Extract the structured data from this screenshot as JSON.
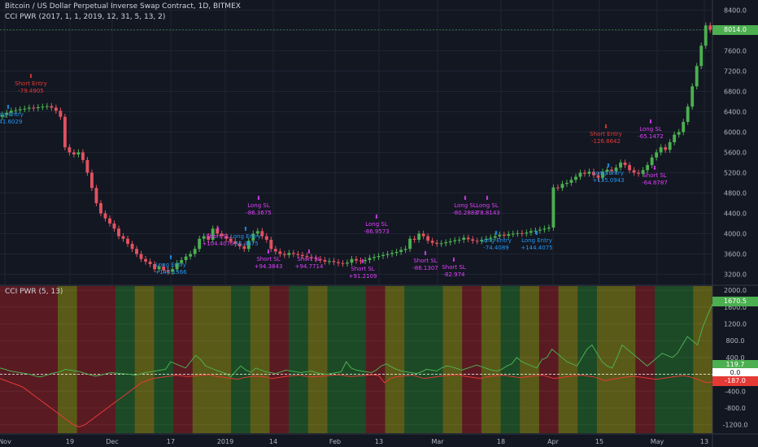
{
  "header": {
    "symbol_title": "Bitcoin / US Dollar Perpetual Inverse Swap Contract, 1D, BITMEX",
    "study_title": "CCI PWR (2017, 1, 1, 2019, 12, 31, 5, 13, 2)",
    "indicator_title": "CCI PWR (5, 13)"
  },
  "colors": {
    "background": "#131722",
    "up_candle": "#4caf50",
    "down_candle": "#e05260",
    "long_signal": "#2196f3",
    "short_signal": "#e040fb",
    "entry_short": "#e53935",
    "cci_up": "#4caf50",
    "cci_down": "#e53935",
    "current_price_box": "#4caf50"
  },
  "price_axis": {
    "ticks": [
      "8400.0",
      "8000.0",
      "7600.0",
      "7200.0",
      "6800.0",
      "6400.0",
      "6000.0",
      "5600.0",
      "5200.0",
      "4800.0",
      "4400.0",
      "4000.0",
      "3600.0",
      "3200.0"
    ],
    "current": "8014.0"
  },
  "osc_axis": {
    "ticks": [
      "2000.0",
      "1600.0",
      "1200.0",
      "800.0",
      "400.0",
      "0.0",
      "-400.0",
      "-800.0",
      "-1200.0"
    ],
    "value_up": "1670.5",
    "value_mid": "119.7",
    "value_zero": "0.0",
    "value_down": "-187.0"
  },
  "time_axis": [
    "Nov",
    "19",
    "Dec",
    "17",
    "2019",
    "14",
    "Feb",
    "13",
    "Mar",
    "18",
    "Apr",
    "15",
    "May",
    "13"
  ],
  "chart_data": {
    "type": "candlestick",
    "series_prices": [
      6340,
      6380,
      6420,
      6430,
      6450,
      6460,
      6480,
      6470,
      6490,
      6500,
      6510,
      6480,
      6420,
      6300,
      5700,
      5600,
      5560,
      5600,
      5450,
      5200,
      4900,
      4600,
      4400,
      4300,
      4200,
      4100,
      3950,
      3900,
      3800,
      3700,
      3600,
      3500,
      3450,
      3400,
      3300,
      3350,
      3280,
      3250,
      3300,
      3420,
      3480,
      3550,
      3600,
      3700,
      3900,
      3950,
      3880,
      4100,
      4000,
      3950,
      3900,
      3850,
      3800,
      3750,
      3700,
      3860,
      4000,
      4050,
      3950,
      3880,
      3700,
      3650,
      3600,
      3580,
      3620,
      3600,
      3580,
      3560,
      3540,
      3520,
      3500,
      3480,
      3450,
      3460,
      3440,
      3420,
      3410,
      3430,
      3500,
      3470,
      3460,
      3480,
      3520,
      3540,
      3560,
      3580,
      3600,
      3620,
      3640,
      3680,
      3700,
      3900,
      3880,
      4000,
      3950,
      3860,
      3820,
      3800,
      3810,
      3830,
      3850,
      3870,
      3880,
      3920,
      3890,
      3860,
      3850,
      3880,
      3900,
      3920,
      3950,
      3980,
      3960,
      3990,
      4000,
      4010,
      4000,
      4020,
      4050,
      4060,
      4080,
      4100,
      4120,
      4910,
      4900,
      4980,
      5000,
      5060,
      5120,
      5200,
      5180,
      5220,
      5150,
      5100,
      5220,
      5260,
      5230,
      5300,
      5400,
      5350,
      5250,
      5200,
      5180,
      5250,
      5350,
      5500,
      5600,
      5700,
      5650,
      5800,
      5950,
      6000,
      6200,
      6500,
      6900,
      7300,
      7700,
      8100,
      8014
    ],
    "signals": [
      {
        "text": "Long Entry",
        "value": "+41.6029",
        "color": "long"
      },
      {
        "text": "Short Entry",
        "value": "-79.4905",
        "color": "short_entry"
      },
      {
        "text": "Long Entry",
        "value": "+144.1566",
        "color": "long"
      },
      {
        "text": "Short SL",
        "value": "+104.4075",
        "color": "short"
      },
      {
        "text": "Long SL",
        "value": "-86.3675",
        "color": "short"
      },
      {
        "text": "Long Entry",
        "value": "-86.3675",
        "color": "long"
      },
      {
        "text": "Short SL",
        "value": "+94.3843",
        "color": "short"
      },
      {
        "text": "Short SL",
        "value": "+94.7714",
        "color": "short"
      },
      {
        "text": "Short SL",
        "value": "+91.2109",
        "color": "short"
      },
      {
        "text": "Long SL",
        "value": "-86.9573",
        "color": "short"
      },
      {
        "text": "Short SL",
        "value": "-86.1307",
        "color": "short"
      },
      {
        "text": "Short SL",
        "value": "-82.974",
        "color": "short"
      },
      {
        "text": "Long SL",
        "value": "-80.2883",
        "color": "short"
      },
      {
        "text": "Long SL",
        "value": "-78.8143",
        "color": "short"
      },
      {
        "text": "Long Entry",
        "value": "-74.4089",
        "color": "long"
      },
      {
        "text": "Long Entry",
        "value": "+144.4075",
        "color": "long"
      },
      {
        "text": "Short Entry",
        "value": "-126.8642",
        "color": "short_entry"
      },
      {
        "text": "Long SL",
        "value": "-65.1472",
        "color": "short"
      },
      {
        "text": "Long Entry",
        "value": "+135.0943",
        "color": "long"
      },
      {
        "text": "Short SL",
        "value": "-64.8787",
        "color": "short"
      }
    ],
    "cci_up_values": [
      150,
      120,
      80,
      60,
      40,
      20,
      0,
      -40,
      -60,
      -30,
      10,
      40,
      60,
      120,
      100,
      80,
      60,
      20,
      -10,
      -40,
      -20,
      10,
      40,
      30,
      20,
      10,
      0,
      -20,
      10,
      40,
      60,
      80,
      100,
      120,
      300,
      250,
      200,
      150,
      300,
      450,
      350,
      200,
      150,
      100,
      60,
      20,
      -60,
      80,
      200,
      100,
      50,
      150,
      100,
      60,
      40,
      20,
      60,
      100,
      80,
      60,
      40,
      60,
      80,
      40,
      20,
      0,
      20,
      40,
      60,
      300,
      150,
      100,
      80,
      60,
      40,
      100,
      200,
      250,
      180,
      120,
      80,
      60,
      40,
      20,
      60,
      120,
      100,
      80,
      150,
      200,
      180,
      140,
      100,
      140,
      180,
      220,
      180,
      140,
      100,
      80,
      120,
      200,
      250,
      400,
      300,
      250,
      200,
      150,
      350,
      400,
      600,
      500,
      400,
      300,
      250,
      200,
      400,
      600,
      700,
      500,
      300,
      200,
      150,
      400,
      700,
      600,
      500,
      400,
      300,
      200,
      300,
      400,
      500,
      450,
      400,
      500,
      700,
      900,
      800,
      700,
      1100,
      1400,
      1670
    ],
    "cci_down_values": [
      -100,
      -150,
      -200,
      -250,
      -300,
      -400,
      -500,
      -600,
      -700,
      -800,
      -900,
      -1000,
      -1100,
      -1200,
      -1250,
      -1200,
      -1100,
      -1000,
      -900,
      -800,
      -700,
      -600,
      -500,
      -400,
      -300,
      -200,
      -150,
      -100,
      -80,
      -60,
      -40,
      -20,
      -30,
      -50,
      -40,
      -30,
      -20,
      -10,
      -40,
      -60,
      -80,
      -100,
      -120,
      -80,
      -60,
      -40,
      -50,
      -60,
      -100,
      -80,
      -60,
      -40,
      -30,
      -20,
      -40,
      -60,
      -50,
      -40,
      -30,
      -20,
      -10,
      -30,
      -50,
      -40,
      -30,
      -20,
      -10,
      -30,
      -200,
      -100,
      -60,
      -40,
      -30,
      -20,
      -60,
      -100,
      -80,
      -60,
      -40,
      -30,
      -20,
      -10,
      -40,
      -60,
      -80,
      -100,
      -60,
      -40,
      -30,
      -20,
      -40,
      -60,
      -80,
      -60,
      -40,
      -30,
      -20,
      -60,
      -100,
      -80,
      -60,
      -40,
      -30,
      -20,
      -40,
      -60,
      -100,
      -150,
      -120,
      -100,
      -80,
      -60,
      -40,
      -60,
      -80,
      -100,
      -120,
      -100,
      -80,
      -60,
      -40,
      -30,
      -60,
      -100,
      -150,
      -200,
      -187
    ],
    "background_zones": [
      "red",
      "red",
      "red",
      "olive",
      "red",
      "red",
      "green",
      "olive",
      "green",
      "red",
      "olive",
      "olive",
      "green",
      "olive",
      "red",
      "green",
      "olive",
      "green",
      "green",
      "red",
      "olive",
      "green",
      "green",
      "olive",
      "red",
      "olive",
      "green",
      "olive",
      "red",
      "olive",
      "green",
      "olive",
      "olive",
      "red",
      "green",
      "green",
      "olive"
    ]
  }
}
